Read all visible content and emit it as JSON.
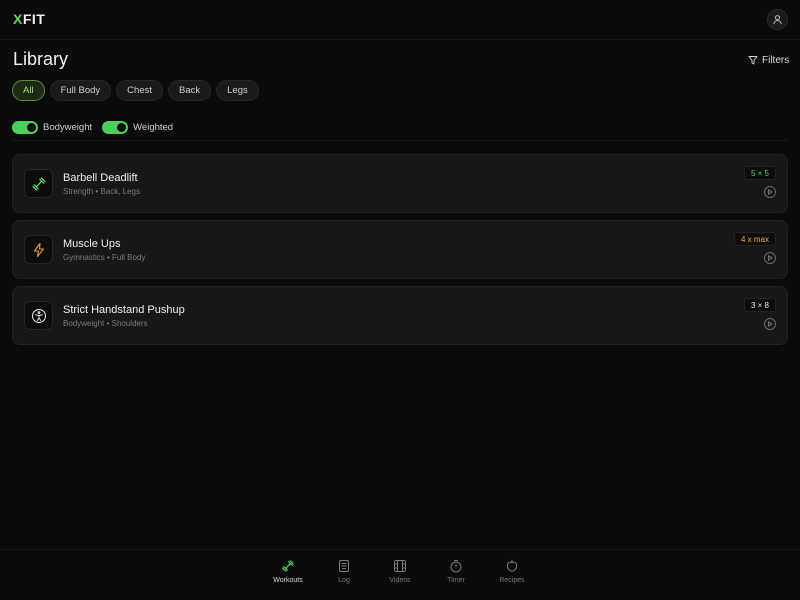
{
  "app": {
    "logo_accent": "X",
    "logo_rest": "FIT"
  },
  "header": {
    "title": "Library",
    "filters_label": "Filters"
  },
  "chips": [
    {
      "label": "All",
      "active": true
    },
    {
      "label": "Full Body",
      "active": false
    },
    {
      "label": "Chest",
      "active": false
    },
    {
      "label": "Back",
      "active": false
    },
    {
      "label": "Legs",
      "active": false
    }
  ],
  "toggles": [
    {
      "label": "Bodyweight",
      "on": true
    },
    {
      "label": "Weighted",
      "on": true
    }
  ],
  "workouts": [
    {
      "title": "Barbell Deadlift",
      "subtitle": "Strength • Back, Legs",
      "badge": "5 × 5",
      "badge_color": "#5fd35a",
      "icon": "dumbbell-icon",
      "icon_color": "#5fd35a"
    },
    {
      "title": "Muscle Ups",
      "subtitle": "Gymnastics • Full Body",
      "badge": "4 x max",
      "badge_color": "#f0b040",
      "icon": "lightning-icon",
      "icon_color": "#e0a030"
    },
    {
      "title": "Strict Handstand Pushup",
      "subtitle": "Bodyweight • Shoulders",
      "badge": "3 × 8",
      "badge_color": "#e8e8e8",
      "icon": "person-icon",
      "icon_color": "#e8e8e8"
    }
  ],
  "nav": [
    {
      "label": "Workouts",
      "icon": "dumbbell-icon",
      "active": true
    },
    {
      "label": "Log",
      "icon": "notebook-icon",
      "active": false
    },
    {
      "label": "Videos",
      "icon": "film-icon",
      "active": false
    },
    {
      "label": "Timer",
      "icon": "stopwatch-icon",
      "active": false
    },
    {
      "label": "Recipes",
      "icon": "apple-icon",
      "active": false
    }
  ],
  "colors": {
    "accent": "#5fd35a",
    "background": "#0b0b0b",
    "card": "#171717"
  }
}
